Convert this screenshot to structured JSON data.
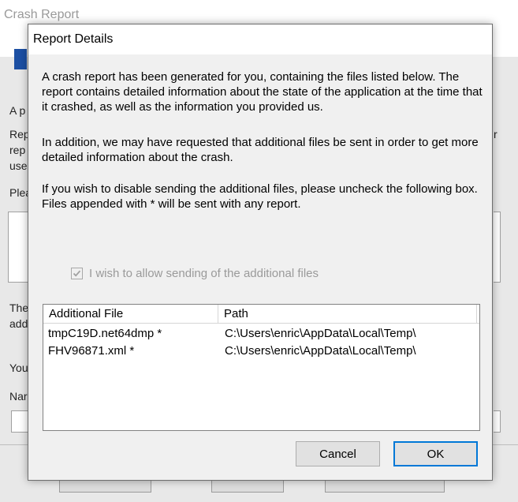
{
  "background_window": {
    "title": "Crash Report",
    "partial_labels": [
      "A p",
      "Rep",
      "rep",
      "use",
      "Plea",
      "The",
      "add",
      "You",
      "Nar",
      "r"
    ]
  },
  "dialog": {
    "title": "Report Details",
    "paragraphs": [
      "A crash report has been generated for you, containing the files listed below. The report contains detailed information about the state of the application at the time that it crashed, as well as the information you provided us.",
      "In addition, we may have requested that additional files be sent in order to get more detailed information about the crash.",
      "If you wish to disable sending the additional files, please uncheck the following box.  Files appended with * will be sent with any report."
    ],
    "checkbox": {
      "label": "I wish to allow sending of the additional files",
      "checked": true,
      "enabled": false
    },
    "file_list": {
      "columns": [
        "Additional File",
        "Path"
      ],
      "rows": [
        {
          "file": "tmpC19D.net64dmp *",
          "path": "C:\\Users\\enric\\AppData\\Local\\Temp\\"
        },
        {
          "file": "FHV96871.xml *",
          "path": "C:\\Users\\enric\\AppData\\Local\\Temp\\"
        }
      ]
    },
    "buttons": {
      "cancel": "Cancel",
      "ok": "OK"
    }
  },
  "colors": {
    "accent": "#0078d7",
    "logo": "#1c4fa3"
  }
}
